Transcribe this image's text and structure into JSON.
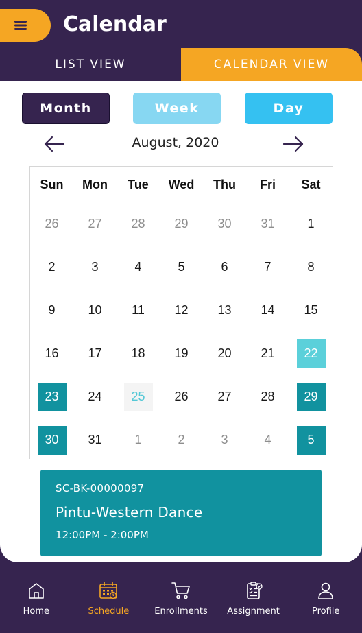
{
  "header": {
    "title": "Calendar",
    "menu_icon": "hamburger-menu-icon"
  },
  "tabs": [
    {
      "label": "LIST VIEW",
      "active": false
    },
    {
      "label": "CALENDAR VIEW",
      "active": true
    }
  ],
  "view_toggle": {
    "month": "Month",
    "week": "Week",
    "day": "Day",
    "selected": "Month"
  },
  "calendar": {
    "month_label": "August, 2020",
    "prev_icon": "arrow-left-icon",
    "next_icon": "arrow-right-icon",
    "weekdays": [
      "Sun",
      "Mon",
      "Tue",
      "Wed",
      "Thu",
      "Fri",
      "Sat"
    ],
    "weeks": [
      [
        "26",
        "27",
        "28",
        "29",
        "30",
        "31",
        "1"
      ],
      [
        "2",
        "3",
        "4",
        "5",
        "6",
        "7",
        "8"
      ],
      [
        "9",
        "10",
        "11",
        "12",
        "13",
        "14",
        "15"
      ],
      [
        "16",
        "17",
        "18",
        "19",
        "20",
        "21",
        "22"
      ],
      [
        "23",
        "24",
        "25",
        "26",
        "27",
        "28",
        "29"
      ],
      [
        "30",
        "31",
        "1",
        "2",
        "3",
        "4",
        "5"
      ]
    ]
  },
  "event": {
    "id": "SC-BK-00000097",
    "title": "Pintu-Western Dance",
    "time": "12:00PM - 2:00PM"
  },
  "bottom_nav": [
    {
      "label": "Home",
      "icon": "home-icon",
      "active": false
    },
    {
      "label": "Schedule",
      "icon": "calendar-icon",
      "active": true
    },
    {
      "label": "Enrollments",
      "icon": "cart-icon",
      "active": false
    },
    {
      "label": "Assignment",
      "icon": "clipboard-icon",
      "active": false
    },
    {
      "label": "Profile",
      "icon": "user-icon",
      "active": false
    }
  ],
  "colors": {
    "brand_dark": "#36244f",
    "accent_orange": "#f5a623",
    "teal": "#11929f",
    "light_teal": "#5bd0da",
    "week_button": "#87d7f2",
    "day_button": "#35c1f1"
  }
}
